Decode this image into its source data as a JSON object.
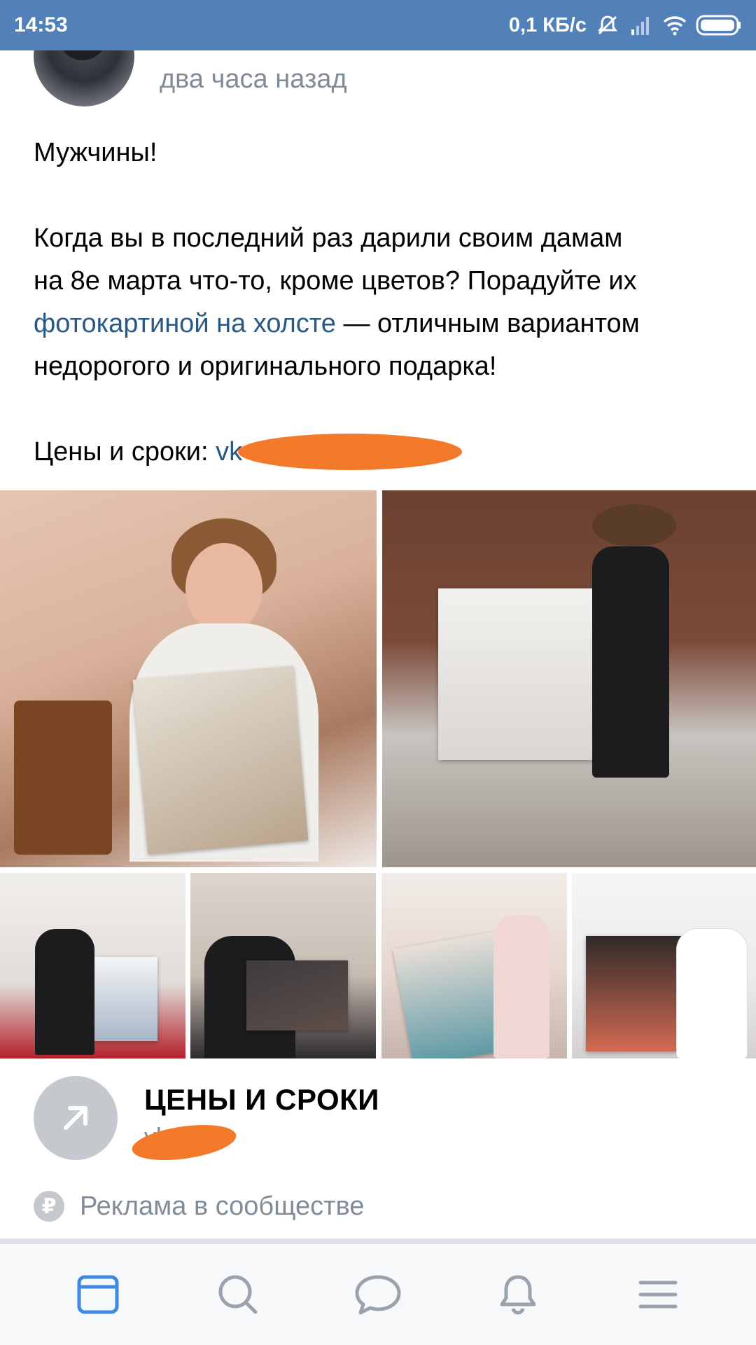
{
  "status_bar": {
    "time": "14:53",
    "speed": "0,1 КБ/с",
    "icons": [
      "mute-icon",
      "signal-icon",
      "wifi-icon",
      "battery-icon"
    ]
  },
  "post": {
    "time": "два часа назад",
    "text": {
      "greeting": "Мужчины!",
      "line1": "Когда вы в последний раз дарили своим дамам",
      "line2": "на 8е марта что-то, кроме цветов? Порадуйте их",
      "link_text": "фотокартиной на холсте",
      "line3_rest": " — отличным вариантом",
      "line4": "недорогого и оригинального подарка!",
      "prices_label": "Цены и сроки: ",
      "prices_link": "vk"
    }
  },
  "link_card": {
    "title": "ЦЕНЫ И СРОКИ",
    "subtitle": "vk.me"
  },
  "ad": {
    "label": "Реклама в сообществе",
    "symbol": "₽"
  },
  "bottom_nav": {
    "items": [
      "news-icon",
      "search-icon",
      "messages-icon",
      "notifications-icon",
      "menu-icon"
    ],
    "active_color": "#3f8ae0",
    "inactive_color": "#99a2ad"
  },
  "colors": {
    "status_bar": "#5181b8",
    "link": "#2a5885",
    "secondary_text": "#818c99"
  }
}
